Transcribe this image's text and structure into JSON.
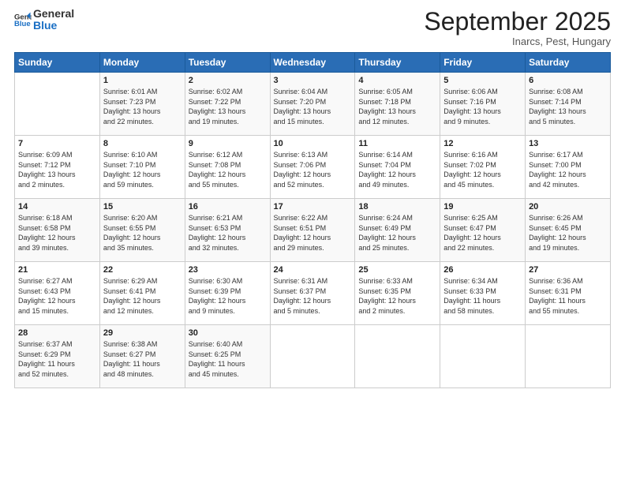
{
  "logo": {
    "line1": "General",
    "line2": "Blue"
  },
  "title": "September 2025",
  "subtitle": "Inarcs, Pest, Hungary",
  "days_of_week": [
    "Sunday",
    "Monday",
    "Tuesday",
    "Wednesday",
    "Thursday",
    "Friday",
    "Saturday"
  ],
  "weeks": [
    [
      {
        "day": "",
        "content": ""
      },
      {
        "day": "1",
        "content": "Sunrise: 6:01 AM\nSunset: 7:23 PM\nDaylight: 13 hours\nand 22 minutes."
      },
      {
        "day": "2",
        "content": "Sunrise: 6:02 AM\nSunset: 7:22 PM\nDaylight: 13 hours\nand 19 minutes."
      },
      {
        "day": "3",
        "content": "Sunrise: 6:04 AM\nSunset: 7:20 PM\nDaylight: 13 hours\nand 15 minutes."
      },
      {
        "day": "4",
        "content": "Sunrise: 6:05 AM\nSunset: 7:18 PM\nDaylight: 13 hours\nand 12 minutes."
      },
      {
        "day": "5",
        "content": "Sunrise: 6:06 AM\nSunset: 7:16 PM\nDaylight: 13 hours\nand 9 minutes."
      },
      {
        "day": "6",
        "content": "Sunrise: 6:08 AM\nSunset: 7:14 PM\nDaylight: 13 hours\nand 5 minutes."
      }
    ],
    [
      {
        "day": "7",
        "content": "Sunrise: 6:09 AM\nSunset: 7:12 PM\nDaylight: 13 hours\nand 2 minutes."
      },
      {
        "day": "8",
        "content": "Sunrise: 6:10 AM\nSunset: 7:10 PM\nDaylight: 12 hours\nand 59 minutes."
      },
      {
        "day": "9",
        "content": "Sunrise: 6:12 AM\nSunset: 7:08 PM\nDaylight: 12 hours\nand 55 minutes."
      },
      {
        "day": "10",
        "content": "Sunrise: 6:13 AM\nSunset: 7:06 PM\nDaylight: 12 hours\nand 52 minutes."
      },
      {
        "day": "11",
        "content": "Sunrise: 6:14 AM\nSunset: 7:04 PM\nDaylight: 12 hours\nand 49 minutes."
      },
      {
        "day": "12",
        "content": "Sunrise: 6:16 AM\nSunset: 7:02 PM\nDaylight: 12 hours\nand 45 minutes."
      },
      {
        "day": "13",
        "content": "Sunrise: 6:17 AM\nSunset: 7:00 PM\nDaylight: 12 hours\nand 42 minutes."
      }
    ],
    [
      {
        "day": "14",
        "content": "Sunrise: 6:18 AM\nSunset: 6:58 PM\nDaylight: 12 hours\nand 39 minutes."
      },
      {
        "day": "15",
        "content": "Sunrise: 6:20 AM\nSunset: 6:55 PM\nDaylight: 12 hours\nand 35 minutes."
      },
      {
        "day": "16",
        "content": "Sunrise: 6:21 AM\nSunset: 6:53 PM\nDaylight: 12 hours\nand 32 minutes."
      },
      {
        "day": "17",
        "content": "Sunrise: 6:22 AM\nSunset: 6:51 PM\nDaylight: 12 hours\nand 29 minutes."
      },
      {
        "day": "18",
        "content": "Sunrise: 6:24 AM\nSunset: 6:49 PM\nDaylight: 12 hours\nand 25 minutes."
      },
      {
        "day": "19",
        "content": "Sunrise: 6:25 AM\nSunset: 6:47 PM\nDaylight: 12 hours\nand 22 minutes."
      },
      {
        "day": "20",
        "content": "Sunrise: 6:26 AM\nSunset: 6:45 PM\nDaylight: 12 hours\nand 19 minutes."
      }
    ],
    [
      {
        "day": "21",
        "content": "Sunrise: 6:27 AM\nSunset: 6:43 PM\nDaylight: 12 hours\nand 15 minutes."
      },
      {
        "day": "22",
        "content": "Sunrise: 6:29 AM\nSunset: 6:41 PM\nDaylight: 12 hours\nand 12 minutes."
      },
      {
        "day": "23",
        "content": "Sunrise: 6:30 AM\nSunset: 6:39 PM\nDaylight: 12 hours\nand 9 minutes."
      },
      {
        "day": "24",
        "content": "Sunrise: 6:31 AM\nSunset: 6:37 PM\nDaylight: 12 hours\nand 5 minutes."
      },
      {
        "day": "25",
        "content": "Sunrise: 6:33 AM\nSunset: 6:35 PM\nDaylight: 12 hours\nand 2 minutes."
      },
      {
        "day": "26",
        "content": "Sunrise: 6:34 AM\nSunset: 6:33 PM\nDaylight: 11 hours\nand 58 minutes."
      },
      {
        "day": "27",
        "content": "Sunrise: 6:36 AM\nSunset: 6:31 PM\nDaylight: 11 hours\nand 55 minutes."
      }
    ],
    [
      {
        "day": "28",
        "content": "Sunrise: 6:37 AM\nSunset: 6:29 PM\nDaylight: 11 hours\nand 52 minutes."
      },
      {
        "day": "29",
        "content": "Sunrise: 6:38 AM\nSunset: 6:27 PM\nDaylight: 11 hours\nand 48 minutes."
      },
      {
        "day": "30",
        "content": "Sunrise: 6:40 AM\nSunset: 6:25 PM\nDaylight: 11 hours\nand 45 minutes."
      },
      {
        "day": "",
        "content": ""
      },
      {
        "day": "",
        "content": ""
      },
      {
        "day": "",
        "content": ""
      },
      {
        "day": "",
        "content": ""
      }
    ]
  ]
}
